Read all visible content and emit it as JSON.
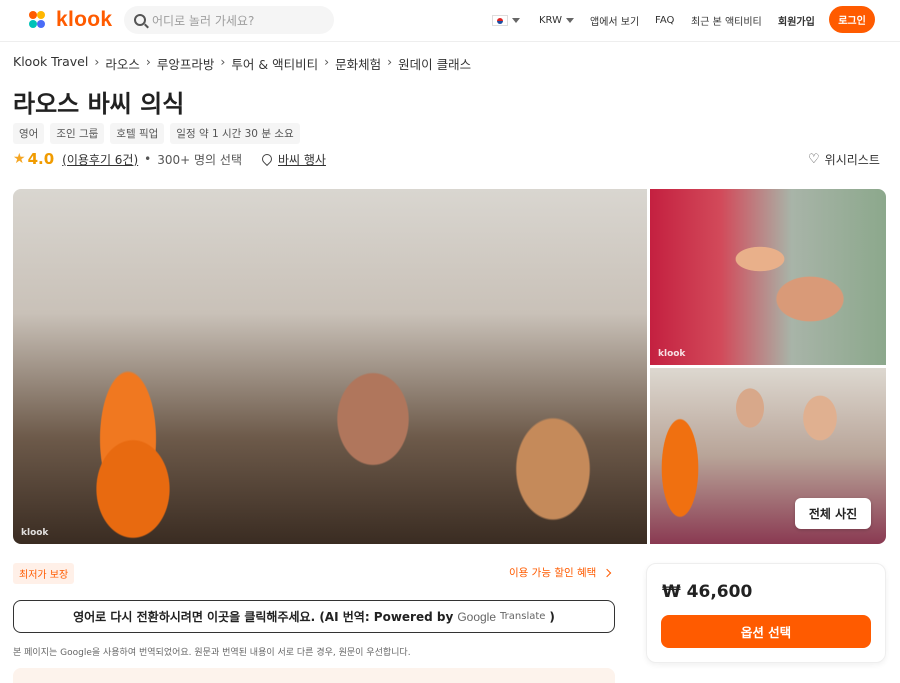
{
  "header": {
    "logo_text": "klook",
    "search_placeholder": "어디로 놀러 가세요?",
    "currency": "KRW",
    "nav_items": [
      "앱에서 보기",
      "FAQ",
      "최근 본 액티비티",
      "회원가입"
    ],
    "login_label": "로그인"
  },
  "breadcrumb": [
    "Klook Travel",
    "라오스",
    "루앙프라방",
    "투어 & 액티비티",
    "문화체험",
    "원데이 클래스"
  ],
  "title": "라오스 바씨 의식",
  "tags": [
    "영어",
    "조인 그룹",
    "호텔 픽업",
    "일정 약 1 시간 30 분 소요"
  ],
  "rating": {
    "score": "4.0",
    "reviews_label": "(이용후기 6건)",
    "bullet": "•",
    "booked": "300+ 명의 선택",
    "location": "바씨 행사"
  },
  "wishlist_label": "위시리스트",
  "gallery": {
    "watermark": "klook",
    "all_photos_label": "전체 사진"
  },
  "lowest_price_badge": "최저가 보장",
  "discount_link": "이용 가능 할인 혜택",
  "translate": {
    "text": "영어로 다시 전환하시려면 이곳을 클릭해주세요. (AI 번역: Powered by",
    "google": "Google",
    "translate_word": "Translate",
    "close_paren": ")"
  },
  "notice": "본 페이지는 Google을 사용하여 번역되었어요. 원문과 번역된 내용이 서로 다른 경우, 원문이 우선합니다.",
  "booking": {
    "price": "₩ 46,600",
    "select_label": "옵션 선택"
  },
  "colors": {
    "brand": "#ff5b00",
    "star": "#f5a623"
  }
}
